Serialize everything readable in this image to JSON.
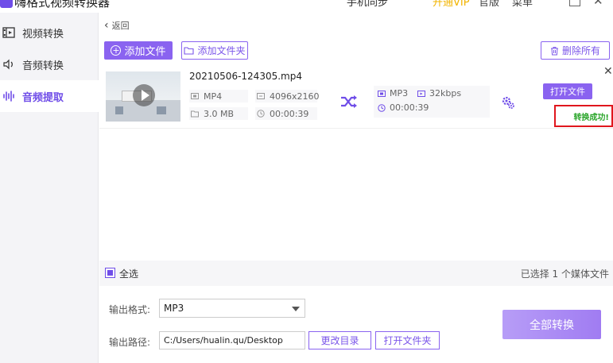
{
  "titlebar": {
    "app_title": "嗨格式视频转换器",
    "mid_text": "手机同步",
    "open_vip": "开通VIP",
    "version": "官版",
    "menu": "菜单"
  },
  "sidebar": {
    "items": [
      {
        "label": "视频转换",
        "icon": "film-icon",
        "active": false
      },
      {
        "label": "音频转换",
        "icon": "audio-convert-icon",
        "active": false
      },
      {
        "label": "音频提取",
        "icon": "waveform-icon",
        "active": true
      }
    ]
  },
  "nav": {
    "back_label": "返回"
  },
  "toolbar": {
    "add_file": "添加文件",
    "add_folder": "添加文件夹",
    "delete_all": "删除所有"
  },
  "file": {
    "name": "20210506-124305.mp4",
    "format": "MP4",
    "resolution": "4096x2160",
    "size": "3.0 MB",
    "duration": "00:00:39",
    "output_format": "MP3",
    "output_bitrate": "32kbps",
    "output_duration": "00:00:39",
    "open_file": "打开文件",
    "status": "转换成功!"
  },
  "selection": {
    "select_all": "全选",
    "info": "已选择 1 个媒体文件"
  },
  "output": {
    "format_label": "输出格式:",
    "format_value": "MP3",
    "path_label": "输出路径:",
    "path_value": "C:/Users/hualin.qu/Desktop",
    "change_dir": "更改目录",
    "open_folder": "打开文件夹",
    "convert_all": "全部转换"
  },
  "colors": {
    "accent": "#8a63f0",
    "success": "#2aa52a",
    "highlight_border": "#e0161d"
  }
}
